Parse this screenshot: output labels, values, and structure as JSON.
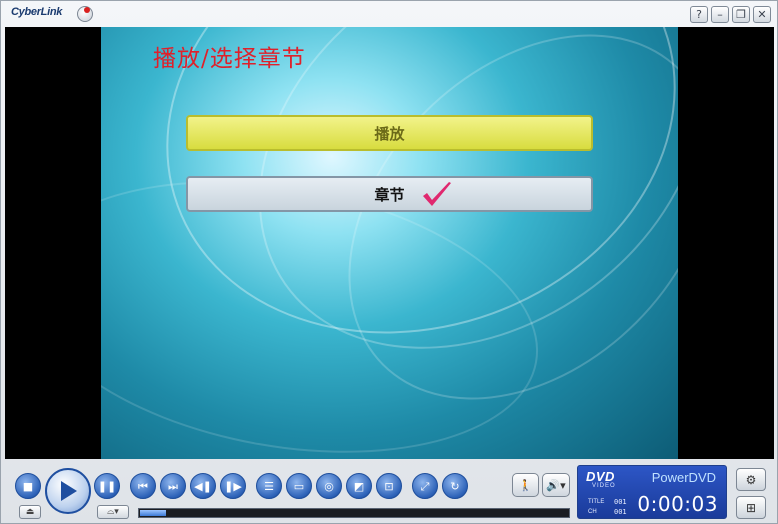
{
  "app": {
    "brand": "CyberLink",
    "window_buttons": {
      "help": "?",
      "minimize": "–",
      "restore": "❐",
      "close": "✕"
    }
  },
  "dvd_menu": {
    "title": "播放/选择章节",
    "buttons": [
      {
        "label": "播放",
        "selected": false
      },
      {
        "label": "章节",
        "selected": true
      }
    ],
    "colors": {
      "title": "#e0202a",
      "play_button": "#e3e64e",
      "chapter_button": "#d6dee6",
      "check": "#e0286f"
    }
  },
  "controls": {
    "icons": {
      "stop": "stop-icon",
      "play": "play-icon",
      "pause": "pause-icon",
      "previous": "previous-icon",
      "next": "next-icon",
      "step_back": "step-backward-icon",
      "step_forward": "step-forward-icon",
      "menu": "menu-icon",
      "subtitle": "subtitle-icon",
      "language": "language-icon",
      "angle": "angle-icon",
      "snapshot": "camera-icon",
      "zoom": "zoom-icon",
      "repeat": "repeat-icon",
      "person": "person-icon",
      "volume": "volume-icon",
      "eject": "eject-icon",
      "drive": "drive-icon",
      "settings": "settings-icon",
      "expand": "expand-panel-icon"
    },
    "seek_progress": 0.06
  },
  "display": {
    "logo": "DVD",
    "logo_sub": "VIDEO",
    "product": "PowerDVD",
    "title_label": "TITLE",
    "title_value": "001",
    "chapter_label": "CH",
    "chapter_value": "001",
    "time": "0:00:03"
  }
}
